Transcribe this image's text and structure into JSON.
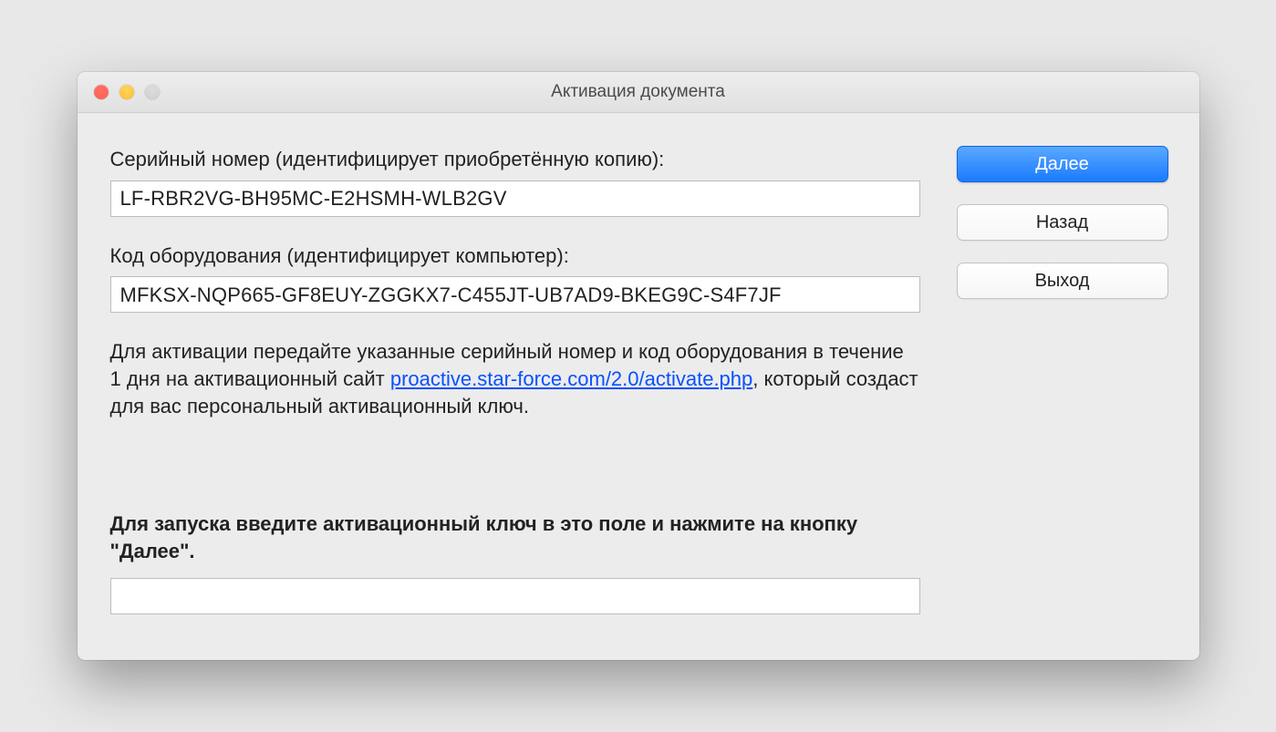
{
  "window": {
    "title": "Активация документа"
  },
  "serial": {
    "label": "Серийный номер (идентифицирует приобретённую копию):",
    "value": "LF-RBR2VG-BH95MC-E2HSMH-WLB2GV"
  },
  "hardware": {
    "label": "Код оборудования (идентифицирует компьютер):",
    "value": "MFKSX-NQP665-GF8EUY-ZGGKX7-C455JT-UB7AD9-BKEG9C-S4F7JF"
  },
  "instructions": {
    "before_link": "Для активации передайте указанные серийный номер и код оборудования в течение 1 дня на активационный сайт ",
    "link_text": "proactive.star-force.com/2.0/activate.php",
    "after_link": ", который создаст для вас персональный активационный ключ."
  },
  "enter_key": {
    "label": "Для запуска введите активационный ключ в это поле и нажмите на кнопку \"Далее\".",
    "value": ""
  },
  "buttons": {
    "next": "Далее",
    "back": "Назад",
    "exit": "Выход"
  }
}
